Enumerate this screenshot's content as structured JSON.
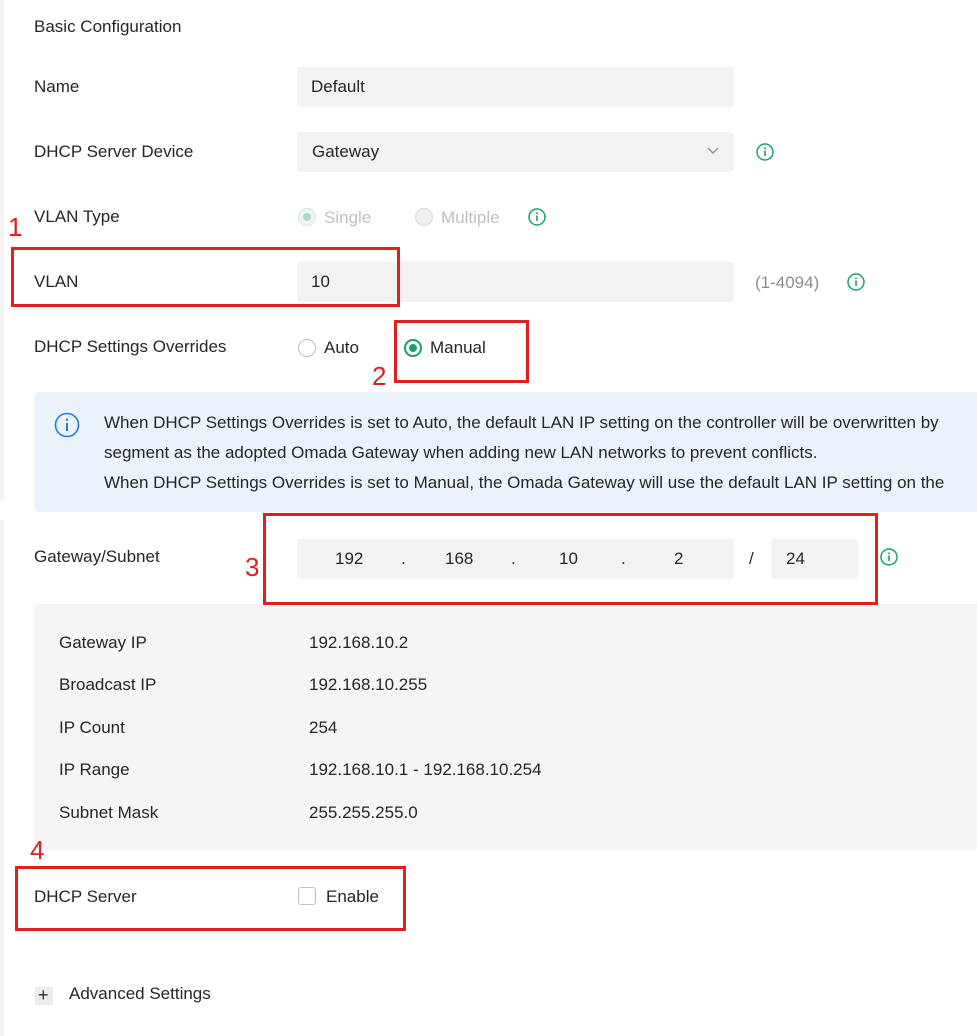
{
  "section_title": "Basic Configuration",
  "name": {
    "label": "Name",
    "value": "Default"
  },
  "dhcp_device": {
    "label": "DHCP Server Device",
    "value": "Gateway"
  },
  "vlan_type": {
    "label": "VLAN Type",
    "options": [
      "Single",
      "Multiple"
    ],
    "selected": "Single"
  },
  "vlan": {
    "label": "VLAN",
    "value": "10",
    "range": "(1-4094)"
  },
  "dhcp_overrides": {
    "label": "DHCP Settings Overrides",
    "options": [
      "Auto",
      "Manual"
    ],
    "selected": "Manual"
  },
  "notice": {
    "line1": "When DHCP Settings Overrides is set to Auto, the default LAN IP setting on the controller will be overwritten by",
    "line2": "segment as the adopted Omada Gateway when adding new LAN networks to prevent conflicts.",
    "line3": "When DHCP Settings Overrides is set to Manual, the Omada Gateway will use the default LAN IP setting on the"
  },
  "gateway_subnet": {
    "label": "Gateway/Subnet",
    "octets": [
      "192",
      "168",
      "10",
      "2"
    ],
    "dot": ".",
    "slash": "/",
    "prefix": "24"
  },
  "summary": [
    {
      "label": "Gateway IP",
      "value": "192.168.10.2"
    },
    {
      "label": "Broadcast IP",
      "value": "192.168.10.255"
    },
    {
      "label": "IP Count",
      "value": "254"
    },
    {
      "label": "IP Range",
      "value": "192.168.10.1 - 192.168.10.254"
    },
    {
      "label": "Subnet Mask",
      "value": "255.255.255.0"
    }
  ],
  "dhcp_server": {
    "label": "DHCP Server",
    "checkbox_label": "Enable",
    "checked": false
  },
  "advanced": {
    "label": "Advanced Settings",
    "toggle": "+"
  },
  "annotations": [
    "1",
    "2",
    "3",
    "4"
  ],
  "colors": {
    "accent": "#1aa06d",
    "annotation": "#e02020",
    "notice_bg": "#eaf3fb",
    "info_blue": "#1f7fd6"
  },
  "icons": {
    "info": "info-circle-icon",
    "dropdown": "chevron-down-icon"
  }
}
